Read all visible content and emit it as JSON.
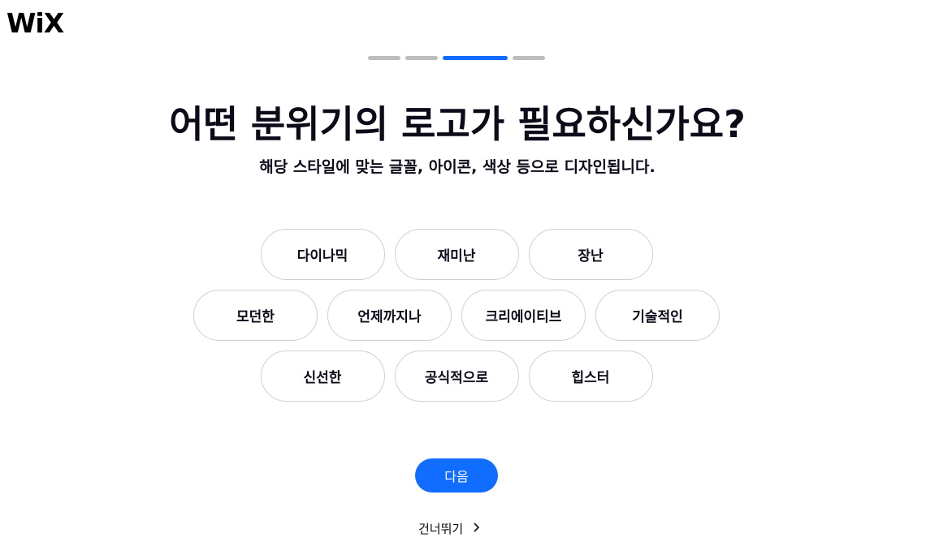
{
  "brand": {
    "logo_text": "WiX"
  },
  "progress": {
    "total_steps": 4,
    "current_step": 3
  },
  "main": {
    "title": "어떤 분위기의 로고가 필요하신가요?",
    "subtitle": "해당 스타일에 맞는 글꼴, 아이콘, 색상 등으로 디자인됩니다."
  },
  "styles": {
    "row1": [
      "다이나믹",
      "재미난",
      "장난"
    ],
    "row2": [
      "모던한",
      "언제까지나",
      "크리에이티브",
      "기술적인"
    ],
    "row3": [
      "신선한",
      "공식적으로",
      "힙스터"
    ]
  },
  "actions": {
    "next_label": "다음",
    "skip_label": "건너뛰기",
    "skip_icon": "chevron-right-icon"
  },
  "colors": {
    "accent": "#116dff",
    "progress_inactive": "#bdbdbd",
    "chip_border": "#cfcfcf",
    "text": "#0b0b1a"
  }
}
